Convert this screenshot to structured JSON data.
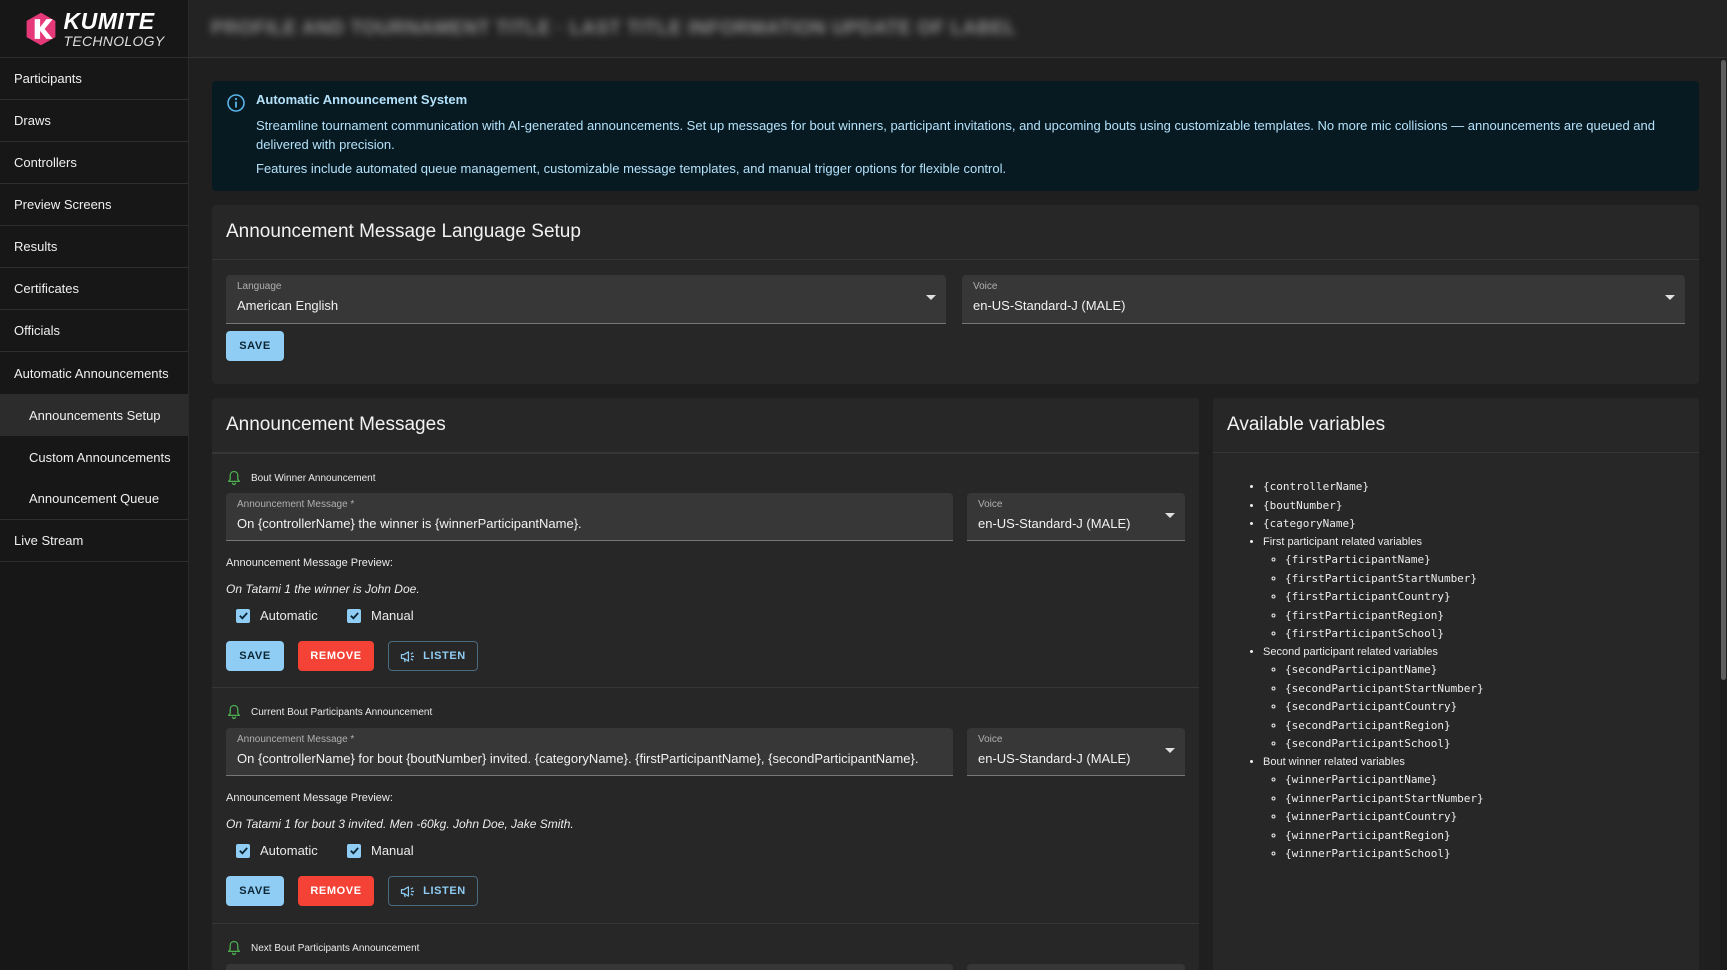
{
  "app": {
    "logo_title": "KUMITE",
    "logo_subtitle": "TECHNOLOGY",
    "topbar_title": "PROFILE AND TOURNAMENT TITLE · LAST TITLE INFORMATION UPDATE OF LABEL"
  },
  "sidebar": {
    "items": [
      {
        "label": "Participants"
      },
      {
        "label": "Draws"
      },
      {
        "label": "Controllers"
      },
      {
        "label": "Preview Screens"
      },
      {
        "label": "Results"
      },
      {
        "label": "Certificates"
      },
      {
        "label": "Officials"
      },
      {
        "label": "Automatic Announcements"
      },
      {
        "label": "Announcements Setup"
      },
      {
        "label": "Custom Announcements"
      },
      {
        "label": "Announcement Queue"
      },
      {
        "label": "Live Stream"
      }
    ]
  },
  "info": {
    "title": "Automatic Announcement System",
    "line1": "Streamline tournament communication with AI-generated announcements. Set up messages for bout winners, participant invitations, and upcoming bouts using customizable templates. No more mic collisions — announcements are queued and delivered with precision.",
    "line2": "Features include automated queue management, customizable message templates, and manual trigger options for flexible control."
  },
  "language_setup": {
    "title": "Announcement Message Language Setup",
    "language_label": "Language",
    "language_value": "American English",
    "voice_label": "Voice",
    "voice_value": "en-US-Standard-J (MALE)",
    "save_label": "SAVE"
  },
  "messages": {
    "title": "Announcement Messages",
    "field_label": "Announcement Message *",
    "voice_label": "Voice",
    "preview_label": "Announcement Message Preview:",
    "automatic_label": "Automatic",
    "manual_label": "Manual",
    "save_label": "SAVE",
    "remove_label": "REMOVE",
    "listen_label": "LISTEN",
    "items": [
      {
        "heading": "Bout Winner Announcement",
        "message": "On {controllerName} the winner is {winnerParticipantName}.",
        "voice": "en-US-Standard-J (MALE)",
        "preview": "On Tatami 1 the winner is John Doe.",
        "automatic": true,
        "manual": true
      },
      {
        "heading": "Current Bout Participants Announcement",
        "message": "On {controllerName} for bout {boutNumber} invited. {categoryName}. {firstParticipantName}, {secondParticipantName}.",
        "voice": "en-US-Standard-J (MALE)",
        "preview": "On Tatami 1 for bout 3 invited. Men -60kg. John Doe, Jake Smith.",
        "automatic": true,
        "manual": true
      },
      {
        "heading": "Next Bout Participants Announcement"
      }
    ]
  },
  "variables": {
    "title": "Available variables",
    "top": [
      "{controllerName}",
      "{boutNumber}",
      "{categoryName}"
    ],
    "groups": [
      {
        "label": "First participant related variables",
        "items": [
          "{firstParticipantName}",
          "{firstParticipantStartNumber}",
          "{firstParticipantCountry}",
          "{firstParticipantRegion}",
          "{firstParticipantSchool}"
        ]
      },
      {
        "label": "Second participant related variables",
        "items": [
          "{secondParticipantName}",
          "{secondParticipantStartNumber}",
          "{secondParticipantCountry}",
          "{secondParticipantRegion}",
          "{secondParticipantSchool}"
        ]
      },
      {
        "label": "Bout winner related variables",
        "items": [
          "{winnerParticipantName}",
          "{winnerParticipantStartNumber}",
          "{winnerParticipantCountry}",
          "{winnerParticipantRegion}",
          "{winnerParticipantSchool}"
        ]
      }
    ]
  },
  "colors": {
    "accent": "#90cdf4",
    "danger": "#f44336",
    "bell": "#4caf50",
    "info_bg": "#071a22"
  },
  "icons": [
    "kumite-logo-icon",
    "info-icon",
    "bell-icon",
    "megaphone-icon",
    "check-icon",
    "dropdown-caret-icon"
  ]
}
